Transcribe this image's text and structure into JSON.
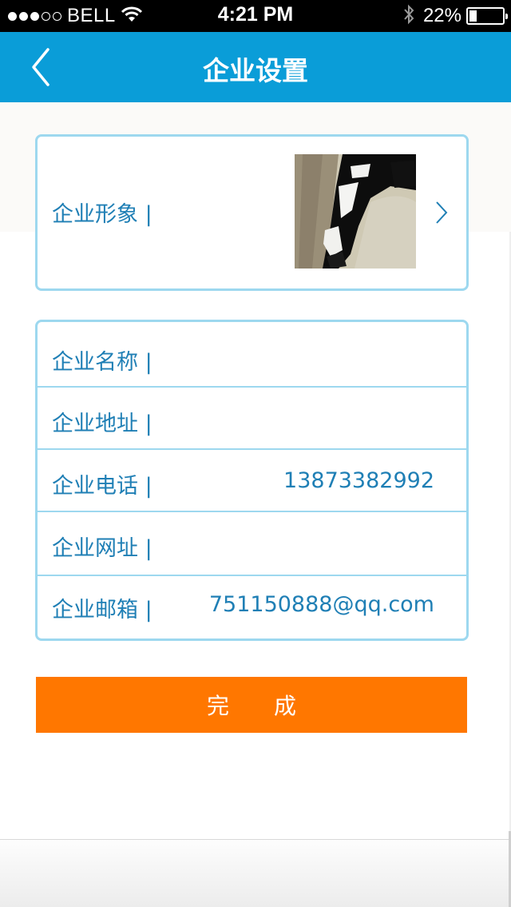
{
  "status_bar": {
    "carrier": "BELL",
    "time": "4:21 PM",
    "battery_percent_text": "22%",
    "battery_level": 0.22,
    "signal_dots_filled": 3,
    "signal_dots_total": 5
  },
  "nav": {
    "title": "企业设置",
    "back_icon": "chevron-left-icon"
  },
  "image_row": {
    "label": "企业形象 |",
    "chevron_icon": "chevron-right-icon"
  },
  "info_rows": [
    {
      "label": "企业名称 |",
      "value": ""
    },
    {
      "label": "企业地址 |",
      "value": ""
    },
    {
      "label": "企业电话 |",
      "value": "13873382992"
    },
    {
      "label": "企业网址 |",
      "value": ""
    },
    {
      "label": "企业邮箱 |",
      "value": "751150888@qq.com"
    }
  ],
  "done_button": {
    "label": "完　　成"
  },
  "colors": {
    "nav_blue": "#0a9dd8",
    "text_blue": "#1f7fb5",
    "border_blue": "#9dd8ef",
    "button_orange": "#ff7700"
  }
}
